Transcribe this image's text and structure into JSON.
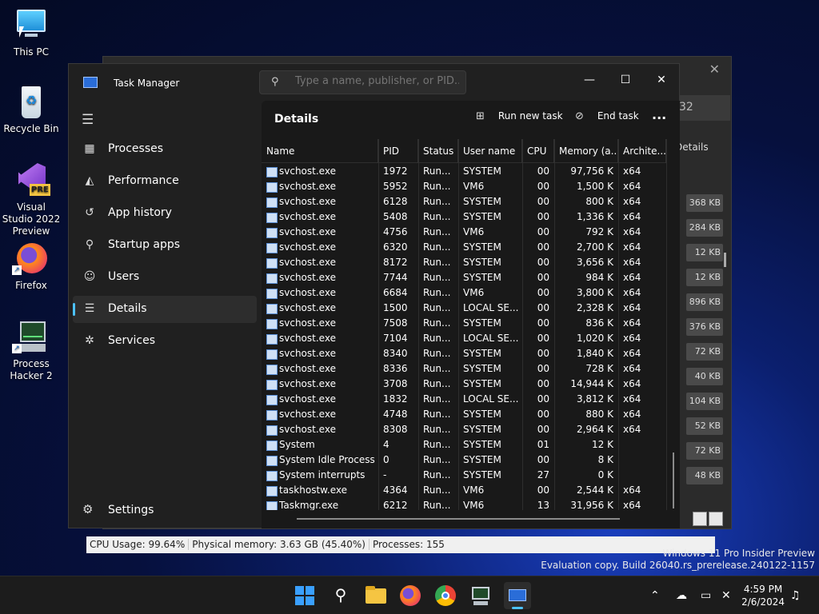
{
  "desktop": {
    "icons": [
      {
        "label": "This PC",
        "icon": "monitor-icon"
      },
      {
        "label": "Recycle Bin",
        "icon": "recycle-bin-icon"
      },
      {
        "label": "Visual Studio 2022 Preview",
        "icon": "visual-studio-icon",
        "badge": "PRE"
      },
      {
        "label": "Firefox",
        "icon": "firefox-icon"
      },
      {
        "label": "Process Hacker 2",
        "icon": "process-hacker-icon"
      }
    ]
  },
  "background_window": {
    "search_fragment": "32",
    "tab_label": "Details",
    "cells": [
      "368 KB",
      "284 KB",
      "12 KB",
      "12 KB",
      "896 KB",
      "376 KB",
      "72 KB",
      "40 KB",
      "104 KB",
      "52 KB",
      "72 KB",
      "48 KB"
    ],
    "status": {
      "cpu": "CPU Usage: 99.64%",
      "memory": "Physical memory: 3.63 GB (45.40%)",
      "processes": "Processes: 155"
    }
  },
  "taskmanager": {
    "title": "Task Manager",
    "search_placeholder": "Type a name, publisher, or PID...",
    "nav": {
      "items": [
        {
          "label": "Processes",
          "icon": "processes-icon",
          "glyph": "▦"
        },
        {
          "label": "Performance",
          "icon": "performance-icon",
          "glyph": "◭"
        },
        {
          "label": "App history",
          "icon": "app-history-icon",
          "glyph": "↺"
        },
        {
          "label": "Startup apps",
          "icon": "startup-apps-icon",
          "glyph": "⚲"
        },
        {
          "label": "Users",
          "icon": "users-icon",
          "glyph": "☺"
        },
        {
          "label": "Details",
          "icon": "details-icon",
          "glyph": "☰"
        },
        {
          "label": "Services",
          "icon": "services-icon",
          "glyph": "✲"
        }
      ],
      "active": "Details",
      "settings_label": "Settings"
    },
    "page_title": "Details",
    "toolbar": {
      "run_new_task": "Run new task",
      "end_task": "End task",
      "more": "..."
    },
    "columns": [
      "Name",
      "PID",
      "Status",
      "User name",
      "CPU",
      "Memory (a...",
      "Archite..."
    ],
    "rows": [
      {
        "name": "svchost.exe",
        "pid": "1972",
        "status": "Run...",
        "user": "SYSTEM",
        "cpu": "00",
        "mem": "97,756 K",
        "arch": "x64"
      },
      {
        "name": "svchost.exe",
        "pid": "5952",
        "status": "Run...",
        "user": "VM6",
        "cpu": "00",
        "mem": "1,500 K",
        "arch": "x64"
      },
      {
        "name": "svchost.exe",
        "pid": "6128",
        "status": "Run...",
        "user": "SYSTEM",
        "cpu": "00",
        "mem": "800 K",
        "arch": "x64"
      },
      {
        "name": "svchost.exe",
        "pid": "5408",
        "status": "Run...",
        "user": "SYSTEM",
        "cpu": "00",
        "mem": "1,336 K",
        "arch": "x64"
      },
      {
        "name": "svchost.exe",
        "pid": "4756",
        "status": "Run...",
        "user": "VM6",
        "cpu": "00",
        "mem": "792 K",
        "arch": "x64"
      },
      {
        "name": "svchost.exe",
        "pid": "6320",
        "status": "Run...",
        "user": "SYSTEM",
        "cpu": "00",
        "mem": "2,700 K",
        "arch": "x64"
      },
      {
        "name": "svchost.exe",
        "pid": "8172",
        "status": "Run...",
        "user": "SYSTEM",
        "cpu": "00",
        "mem": "3,656 K",
        "arch": "x64"
      },
      {
        "name": "svchost.exe",
        "pid": "7744",
        "status": "Run...",
        "user": "SYSTEM",
        "cpu": "00",
        "mem": "984 K",
        "arch": "x64"
      },
      {
        "name": "svchost.exe",
        "pid": "6684",
        "status": "Run...",
        "user": "VM6",
        "cpu": "00",
        "mem": "3,800 K",
        "arch": "x64"
      },
      {
        "name": "svchost.exe",
        "pid": "1500",
        "status": "Run...",
        "user": "LOCAL SE...",
        "cpu": "00",
        "mem": "2,328 K",
        "arch": "x64"
      },
      {
        "name": "svchost.exe",
        "pid": "7508",
        "status": "Run...",
        "user": "SYSTEM",
        "cpu": "00",
        "mem": "836 K",
        "arch": "x64"
      },
      {
        "name": "svchost.exe",
        "pid": "7104",
        "status": "Run...",
        "user": "LOCAL SE...",
        "cpu": "00",
        "mem": "1,020 K",
        "arch": "x64"
      },
      {
        "name": "svchost.exe",
        "pid": "8340",
        "status": "Run...",
        "user": "SYSTEM",
        "cpu": "00",
        "mem": "1,840 K",
        "arch": "x64"
      },
      {
        "name": "svchost.exe",
        "pid": "8336",
        "status": "Run...",
        "user": "SYSTEM",
        "cpu": "00",
        "mem": "728 K",
        "arch": "x64"
      },
      {
        "name": "svchost.exe",
        "pid": "3708",
        "status": "Run...",
        "user": "SYSTEM",
        "cpu": "00",
        "mem": "14,944 K",
        "arch": "x64"
      },
      {
        "name": "svchost.exe",
        "pid": "1832",
        "status": "Run...",
        "user": "LOCAL SE...",
        "cpu": "00",
        "mem": "3,812 K",
        "arch": "x64"
      },
      {
        "name": "svchost.exe",
        "pid": "4748",
        "status": "Run...",
        "user": "SYSTEM",
        "cpu": "00",
        "mem": "880 K",
        "arch": "x64"
      },
      {
        "name": "svchost.exe",
        "pid": "8308",
        "status": "Run...",
        "user": "SYSTEM",
        "cpu": "00",
        "mem": "2,964 K",
        "arch": "x64"
      },
      {
        "name": "System",
        "pid": "4",
        "status": "Run...",
        "user": "SYSTEM",
        "cpu": "01",
        "mem": "12 K",
        "arch": ""
      },
      {
        "name": "System Idle Process",
        "pid": "0",
        "status": "Run...",
        "user": "SYSTEM",
        "cpu": "00",
        "mem": "8 K",
        "arch": ""
      },
      {
        "name": "System interrupts",
        "pid": "-",
        "status": "Run...",
        "user": "SYSTEM",
        "cpu": "27",
        "mem": "0 K",
        "arch": ""
      },
      {
        "name": "taskhostw.exe",
        "pid": "4364",
        "status": "Run...",
        "user": "VM6",
        "cpu": "00",
        "mem": "2,544 K",
        "arch": "x64"
      },
      {
        "name": "Taskmgr.exe",
        "pid": "6212",
        "status": "Run...",
        "user": "VM6",
        "cpu": "13",
        "mem": "31,956 K",
        "arch": "x64"
      }
    ]
  },
  "watermark": {
    "line1": "Windows 11 Pro Insider Preview",
    "line2": "Evaluation copy. Build 26040.rs_prerelease.240122-1157"
  },
  "taskbar": {
    "time": "4:59 PM",
    "date": "2/6/2024"
  },
  "colors": {
    "accent": "#4cc2ff",
    "window_bg": "#202020",
    "content_bg": "#191919"
  }
}
